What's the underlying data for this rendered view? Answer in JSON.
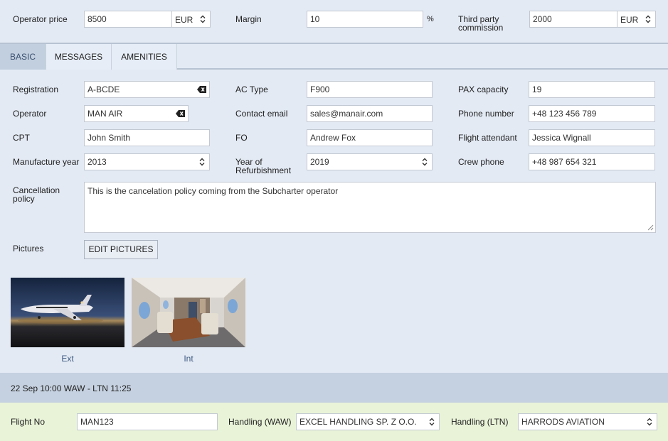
{
  "pricing": {
    "operator_price_label": "Operator price",
    "operator_price_value": "8500",
    "operator_price_currency": "EUR",
    "margin_label": "Margin",
    "margin_value": "10",
    "margin_unit": "%",
    "third_party_label_1": "Third party",
    "third_party_label_2": "commission",
    "third_party_value": "2000",
    "third_party_currency": "EUR"
  },
  "tabs": [
    {
      "label": "BASIC",
      "active": true
    },
    {
      "label": "MESSAGES",
      "active": false
    },
    {
      "label": "AMENITIES",
      "active": false
    }
  ],
  "basic": {
    "registration_label": "Registration",
    "registration_value": "A-BCDE",
    "ac_type_label": "AC Type",
    "ac_type_value": "F900",
    "pax_label": "PAX capacity",
    "pax_value": "19",
    "operator_label": "Operator",
    "operator_value": "MAN AIR",
    "contact_email_label": "Contact email",
    "contact_email_value": "sales@manair.com",
    "phone_label": "Phone number",
    "phone_value": "+48 123 456 789",
    "cpt_label": "CPT",
    "cpt_value": "John Smith",
    "fo_label": "FO",
    "fo_value": "Andrew Fox",
    "fa_label": "Flight attendant",
    "fa_value": "Jessica Wignall",
    "manufacture_label": "Manufacture year",
    "manufacture_value": "2013",
    "refurb_label_1": "Year of",
    "refurb_label_2": "Refurbishment",
    "refurb_value": "2019",
    "crew_phone_label": "Crew phone",
    "crew_phone_value": "+48 987 654 321",
    "cancellation_label_1": "Cancellation",
    "cancellation_label_2": "policy",
    "cancellation_value": "This is the cancelation policy coming from the Subcharter operator",
    "pictures_label": "Pictures",
    "edit_pictures_label": "EDIT PICTURES",
    "pictures": [
      {
        "caption": "Ext"
      },
      {
        "caption": "Int"
      }
    ]
  },
  "flight": {
    "summary": "22 Sep 10:00 WAW - LTN 11:25",
    "flight_no_label": "Flight No",
    "flight_no_value": "MAN123",
    "handling_waw_label": "Handling (WAW)",
    "handling_waw_value": "EXCEL HANDLING SP. Z O.O.",
    "handling_ltn_label": "Handling (LTN)",
    "handling_ltn_value": "HARRODS AVIATION"
  },
  "colors": {
    "background": "#e3eaf4",
    "active_tab": "#c2cfdf",
    "flight_bar": "#c5d1e0",
    "handling_bar": "#e9f3d8",
    "caption_link": "#3f5a80"
  }
}
